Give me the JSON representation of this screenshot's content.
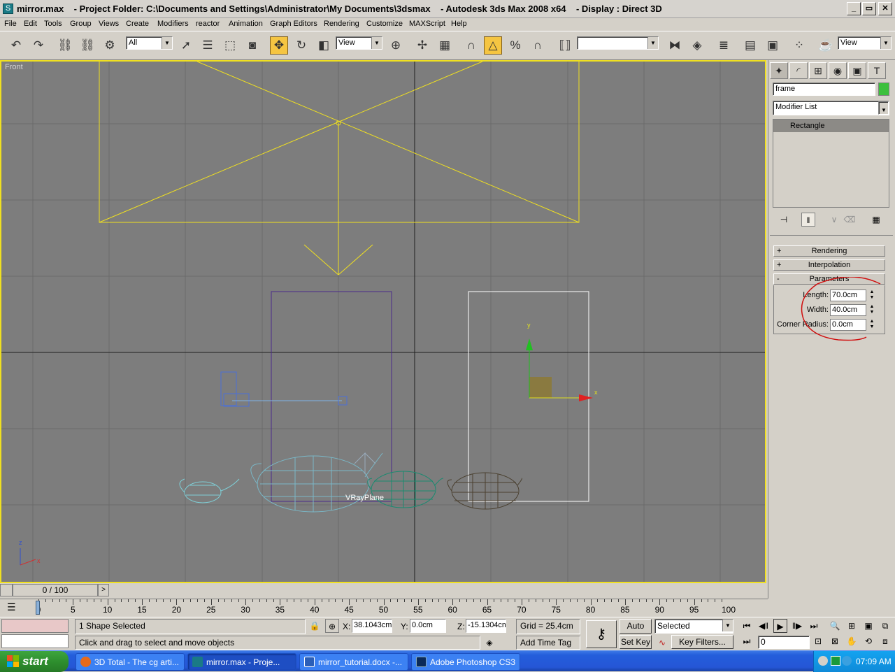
{
  "window": {
    "file": "mirror.max",
    "project": "- Project Folder: C:\\Documents and Settings\\Administrator\\My Documents\\3dsmax",
    "app": "- Autodesk 3ds Max 2008 x64",
    "display": "- Display : Direct 3D",
    "minimize": "_",
    "maximize": "▭",
    "close": "✕"
  },
  "menu": [
    "File",
    "Edit",
    "Tools",
    "Group",
    "Views",
    "Create",
    "Modifiers",
    "reactor",
    "Animation",
    "Graph Editors",
    "Rendering",
    "Customize",
    "MAXScript",
    "Help"
  ],
  "toolbar": {
    "selection_filter": "All",
    "ref_coord": "View",
    "named_sel": "",
    "render_view": "View"
  },
  "viewport": {
    "label": "Front",
    "object_label": "VRayPlane",
    "gizmo_y": "y",
    "gizmo_x": "x",
    "axis_z": "z",
    "axis_x": "x"
  },
  "command_panel": {
    "object_name": "frame",
    "object_color": "#3cc03c",
    "modifier_list": "Modifier List",
    "stack_item": "Rectangle",
    "rollouts": [
      {
        "sign": "+",
        "label": "Rendering"
      },
      {
        "sign": "+",
        "label": "Interpolation"
      },
      {
        "sign": "-",
        "label": "Parameters"
      }
    ],
    "params": [
      {
        "label": "Length:",
        "value": "70.0cm"
      },
      {
        "label": "Width:",
        "value": "40.0cm"
      },
      {
        "label": "Corner Radius:",
        "value": "0.0cm"
      }
    ]
  },
  "timeline": {
    "frame": "0 / 100",
    "ticks": [
      "0",
      "5",
      "10",
      "15",
      "20",
      "25",
      "30",
      "35",
      "40",
      "45",
      "50",
      "55",
      "60",
      "65",
      "70",
      "75",
      "80",
      "85",
      "90",
      "95",
      "100"
    ]
  },
  "status": {
    "selection": "1 Shape Selected",
    "prompt": "Click and drag to select and move objects",
    "x_label": "X:",
    "x": "38.1043cm",
    "y_label": "Y:",
    "y": "0.0cm",
    "z_label": "Z:",
    "z": "-15.1304cm",
    "grid": "Grid = 25.4cm",
    "add_time_tag": "Add Time Tag",
    "auto_key": "Auto Key",
    "set_key": "Set Key",
    "key_mode": "Selected",
    "key_filters": "Key Filters...",
    "current_frame": "0"
  },
  "taskbar": {
    "start": "start",
    "tasks": [
      "3D Total - The cg arti...",
      "mirror.max      - Proje...",
      "mirror_tutorial.docx -...",
      "Adobe Photoshop CS3"
    ],
    "clock": "07:09 AM"
  }
}
